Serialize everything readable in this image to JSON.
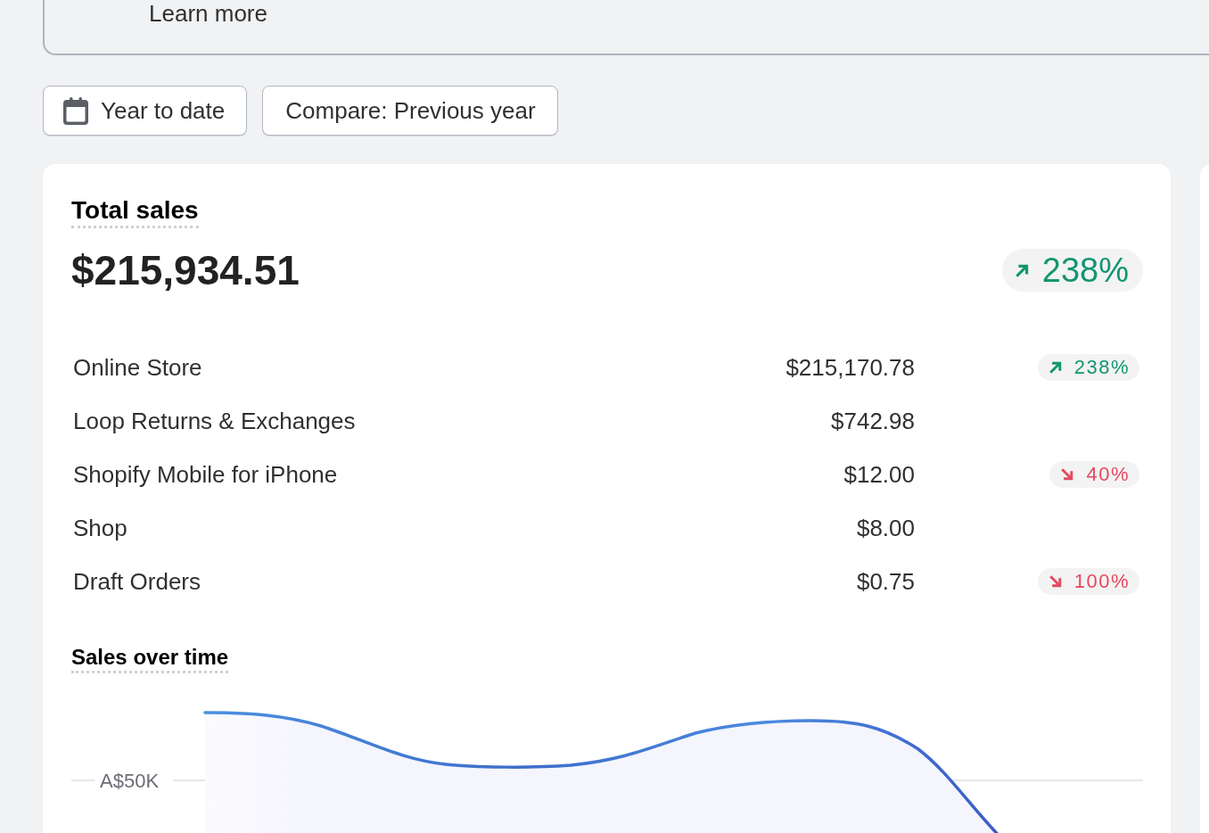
{
  "banner": {
    "link": "Learn more"
  },
  "filters": [
    {
      "kind": "date",
      "label": "Year to date"
    },
    {
      "kind": "compare",
      "label": "Compare: Previous year"
    }
  ],
  "total_sales": {
    "title": "Total sales",
    "value": "$215,934.51",
    "change": {
      "kind": "increase",
      "label": "238%"
    }
  },
  "channels": [
    {
      "name": "Online Store",
      "amount": "$215,170.78",
      "change": {
        "kind": "increase",
        "label": "238%"
      }
    },
    {
      "name": "Loop Returns & Exchanges",
      "amount": "$742.98"
    },
    {
      "name": "Shopify Mobile for iPhone",
      "amount": "$12.00",
      "change": {
        "kind": "decrease",
        "label": "40%"
      }
    },
    {
      "name": "Shop",
      "amount": "$8.00"
    },
    {
      "name": "Draft Orders",
      "amount": "$0.75",
      "change": {
        "kind": "decrease",
        "label": "100%"
      }
    }
  ],
  "sales_over_time": {
    "title": "Sales over time",
    "y_axis_label": "A$50K"
  }
}
